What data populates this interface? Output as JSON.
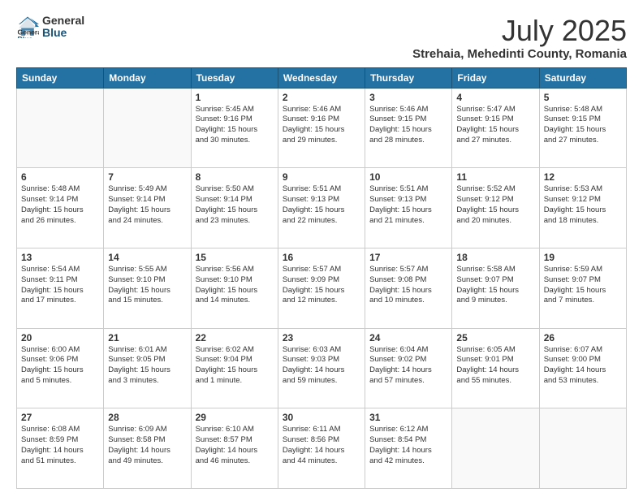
{
  "logo": {
    "general": "General",
    "blue": "Blue"
  },
  "title": "July 2025",
  "subtitle": "Strehaia, Mehedinti County, Romania",
  "weekdays": [
    "Sunday",
    "Monday",
    "Tuesday",
    "Wednesday",
    "Thursday",
    "Friday",
    "Saturday"
  ],
  "weeks": [
    [
      {
        "day": "",
        "info": ""
      },
      {
        "day": "",
        "info": ""
      },
      {
        "day": "1",
        "info": "Sunrise: 5:45 AM\nSunset: 9:16 PM\nDaylight: 15 hours\nand 30 minutes."
      },
      {
        "day": "2",
        "info": "Sunrise: 5:46 AM\nSunset: 9:16 PM\nDaylight: 15 hours\nand 29 minutes."
      },
      {
        "day": "3",
        "info": "Sunrise: 5:46 AM\nSunset: 9:15 PM\nDaylight: 15 hours\nand 28 minutes."
      },
      {
        "day": "4",
        "info": "Sunrise: 5:47 AM\nSunset: 9:15 PM\nDaylight: 15 hours\nand 27 minutes."
      },
      {
        "day": "5",
        "info": "Sunrise: 5:48 AM\nSunset: 9:15 PM\nDaylight: 15 hours\nand 27 minutes."
      }
    ],
    [
      {
        "day": "6",
        "info": "Sunrise: 5:48 AM\nSunset: 9:14 PM\nDaylight: 15 hours\nand 26 minutes."
      },
      {
        "day": "7",
        "info": "Sunrise: 5:49 AM\nSunset: 9:14 PM\nDaylight: 15 hours\nand 24 minutes."
      },
      {
        "day": "8",
        "info": "Sunrise: 5:50 AM\nSunset: 9:14 PM\nDaylight: 15 hours\nand 23 minutes."
      },
      {
        "day": "9",
        "info": "Sunrise: 5:51 AM\nSunset: 9:13 PM\nDaylight: 15 hours\nand 22 minutes."
      },
      {
        "day": "10",
        "info": "Sunrise: 5:51 AM\nSunset: 9:13 PM\nDaylight: 15 hours\nand 21 minutes."
      },
      {
        "day": "11",
        "info": "Sunrise: 5:52 AM\nSunset: 9:12 PM\nDaylight: 15 hours\nand 20 minutes."
      },
      {
        "day": "12",
        "info": "Sunrise: 5:53 AM\nSunset: 9:12 PM\nDaylight: 15 hours\nand 18 minutes."
      }
    ],
    [
      {
        "day": "13",
        "info": "Sunrise: 5:54 AM\nSunset: 9:11 PM\nDaylight: 15 hours\nand 17 minutes."
      },
      {
        "day": "14",
        "info": "Sunrise: 5:55 AM\nSunset: 9:10 PM\nDaylight: 15 hours\nand 15 minutes."
      },
      {
        "day": "15",
        "info": "Sunrise: 5:56 AM\nSunset: 9:10 PM\nDaylight: 15 hours\nand 14 minutes."
      },
      {
        "day": "16",
        "info": "Sunrise: 5:57 AM\nSunset: 9:09 PM\nDaylight: 15 hours\nand 12 minutes."
      },
      {
        "day": "17",
        "info": "Sunrise: 5:57 AM\nSunset: 9:08 PM\nDaylight: 15 hours\nand 10 minutes."
      },
      {
        "day": "18",
        "info": "Sunrise: 5:58 AM\nSunset: 9:07 PM\nDaylight: 15 hours\nand 9 minutes."
      },
      {
        "day": "19",
        "info": "Sunrise: 5:59 AM\nSunset: 9:07 PM\nDaylight: 15 hours\nand 7 minutes."
      }
    ],
    [
      {
        "day": "20",
        "info": "Sunrise: 6:00 AM\nSunset: 9:06 PM\nDaylight: 15 hours\nand 5 minutes."
      },
      {
        "day": "21",
        "info": "Sunrise: 6:01 AM\nSunset: 9:05 PM\nDaylight: 15 hours\nand 3 minutes."
      },
      {
        "day": "22",
        "info": "Sunrise: 6:02 AM\nSunset: 9:04 PM\nDaylight: 15 hours\nand 1 minute."
      },
      {
        "day": "23",
        "info": "Sunrise: 6:03 AM\nSunset: 9:03 PM\nDaylight: 14 hours\nand 59 minutes."
      },
      {
        "day": "24",
        "info": "Sunrise: 6:04 AM\nSunset: 9:02 PM\nDaylight: 14 hours\nand 57 minutes."
      },
      {
        "day": "25",
        "info": "Sunrise: 6:05 AM\nSunset: 9:01 PM\nDaylight: 14 hours\nand 55 minutes."
      },
      {
        "day": "26",
        "info": "Sunrise: 6:07 AM\nSunset: 9:00 PM\nDaylight: 14 hours\nand 53 minutes."
      }
    ],
    [
      {
        "day": "27",
        "info": "Sunrise: 6:08 AM\nSunset: 8:59 PM\nDaylight: 14 hours\nand 51 minutes."
      },
      {
        "day": "28",
        "info": "Sunrise: 6:09 AM\nSunset: 8:58 PM\nDaylight: 14 hours\nand 49 minutes."
      },
      {
        "day": "29",
        "info": "Sunrise: 6:10 AM\nSunset: 8:57 PM\nDaylight: 14 hours\nand 46 minutes."
      },
      {
        "day": "30",
        "info": "Sunrise: 6:11 AM\nSunset: 8:56 PM\nDaylight: 14 hours\nand 44 minutes."
      },
      {
        "day": "31",
        "info": "Sunrise: 6:12 AM\nSunset: 8:54 PM\nDaylight: 14 hours\nand 42 minutes."
      },
      {
        "day": "",
        "info": ""
      },
      {
        "day": "",
        "info": ""
      }
    ]
  ]
}
